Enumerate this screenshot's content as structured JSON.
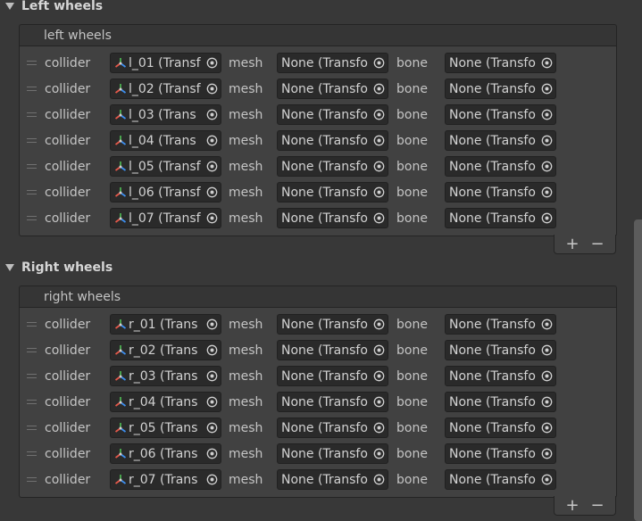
{
  "left_section": {
    "title": "Left wheels",
    "list_label": "left wheels",
    "rows": [
      {
        "collider_label": "collider",
        "collider_value": "l_01 (Transf",
        "mesh_label": "mesh",
        "mesh_value": "None (Transfo",
        "bone_label": "bone",
        "bone_value": "None (Transfo"
      },
      {
        "collider_label": "collider",
        "collider_value": "l_02 (Transf",
        "mesh_label": "mesh",
        "mesh_value": "None (Transfo",
        "bone_label": "bone",
        "bone_value": "None (Transfo"
      },
      {
        "collider_label": "collider",
        "collider_value": "l_03 (Trans",
        "mesh_label": "mesh",
        "mesh_value": "None (Transfo",
        "bone_label": "bone",
        "bone_value": "None (Transfo"
      },
      {
        "collider_label": "collider",
        "collider_value": "l_04 (Trans",
        "mesh_label": "mesh",
        "mesh_value": "None (Transfo",
        "bone_label": "bone",
        "bone_value": "None (Transfo"
      },
      {
        "collider_label": "collider",
        "collider_value": "l_05 (Transf",
        "mesh_label": "mesh",
        "mesh_value": "None (Transfo",
        "bone_label": "bone",
        "bone_value": "None (Transfo"
      },
      {
        "collider_label": "collider",
        "collider_value": "l_06 (Transf",
        "mesh_label": "mesh",
        "mesh_value": "None (Transfo",
        "bone_label": "bone",
        "bone_value": "None (Transfo"
      },
      {
        "collider_label": "collider",
        "collider_value": "l_07 (Transf",
        "mesh_label": "mesh",
        "mesh_value": "None (Transfo",
        "bone_label": "bone",
        "bone_value": "None (Transfo"
      }
    ],
    "add_label": "+",
    "remove_label": "−"
  },
  "right_section": {
    "title": "Right wheels",
    "list_label": "right wheels",
    "rows": [
      {
        "collider_label": "collider",
        "collider_value": "r_01 (Trans",
        "mesh_label": "mesh",
        "mesh_value": "None (Transfo",
        "bone_label": "bone",
        "bone_value": "None (Transfo"
      },
      {
        "collider_label": "collider",
        "collider_value": "r_02 (Trans",
        "mesh_label": "mesh",
        "mesh_value": "None (Transfo",
        "bone_label": "bone",
        "bone_value": "None (Transfo"
      },
      {
        "collider_label": "collider",
        "collider_value": "r_03 (Trans",
        "mesh_label": "mesh",
        "mesh_value": "None (Transfo",
        "bone_label": "bone",
        "bone_value": "None (Transfo"
      },
      {
        "collider_label": "collider",
        "collider_value": "r_04 (Trans",
        "mesh_label": "mesh",
        "mesh_value": "None (Transfo",
        "bone_label": "bone",
        "bone_value": "None (Transfo"
      },
      {
        "collider_label": "collider",
        "collider_value": "r_05 (Trans",
        "mesh_label": "mesh",
        "mesh_value": "None (Transfo",
        "bone_label": "bone",
        "bone_value": "None (Transfo"
      },
      {
        "collider_label": "collider",
        "collider_value": "r_06 (Trans",
        "mesh_label": "mesh",
        "mesh_value": "None (Transfo",
        "bone_label": "bone",
        "bone_value": "None (Transfo"
      },
      {
        "collider_label": "collider",
        "collider_value": "r_07 (Trans",
        "mesh_label": "mesh",
        "mesh_value": "None (Transfo",
        "bone_label": "bone",
        "bone_value": "None (Transfo"
      }
    ],
    "add_label": "+",
    "remove_label": "−"
  },
  "icons": {
    "foldout": "triangle-down-icon",
    "transform": "transform-axes-icon",
    "picker": "object-picker-icon",
    "drag": "drag-handle-icon"
  },
  "colors": {
    "background": "#383838",
    "list_body": "#414141",
    "field": "#2a2a2a",
    "text": "#c4c4c4"
  }
}
